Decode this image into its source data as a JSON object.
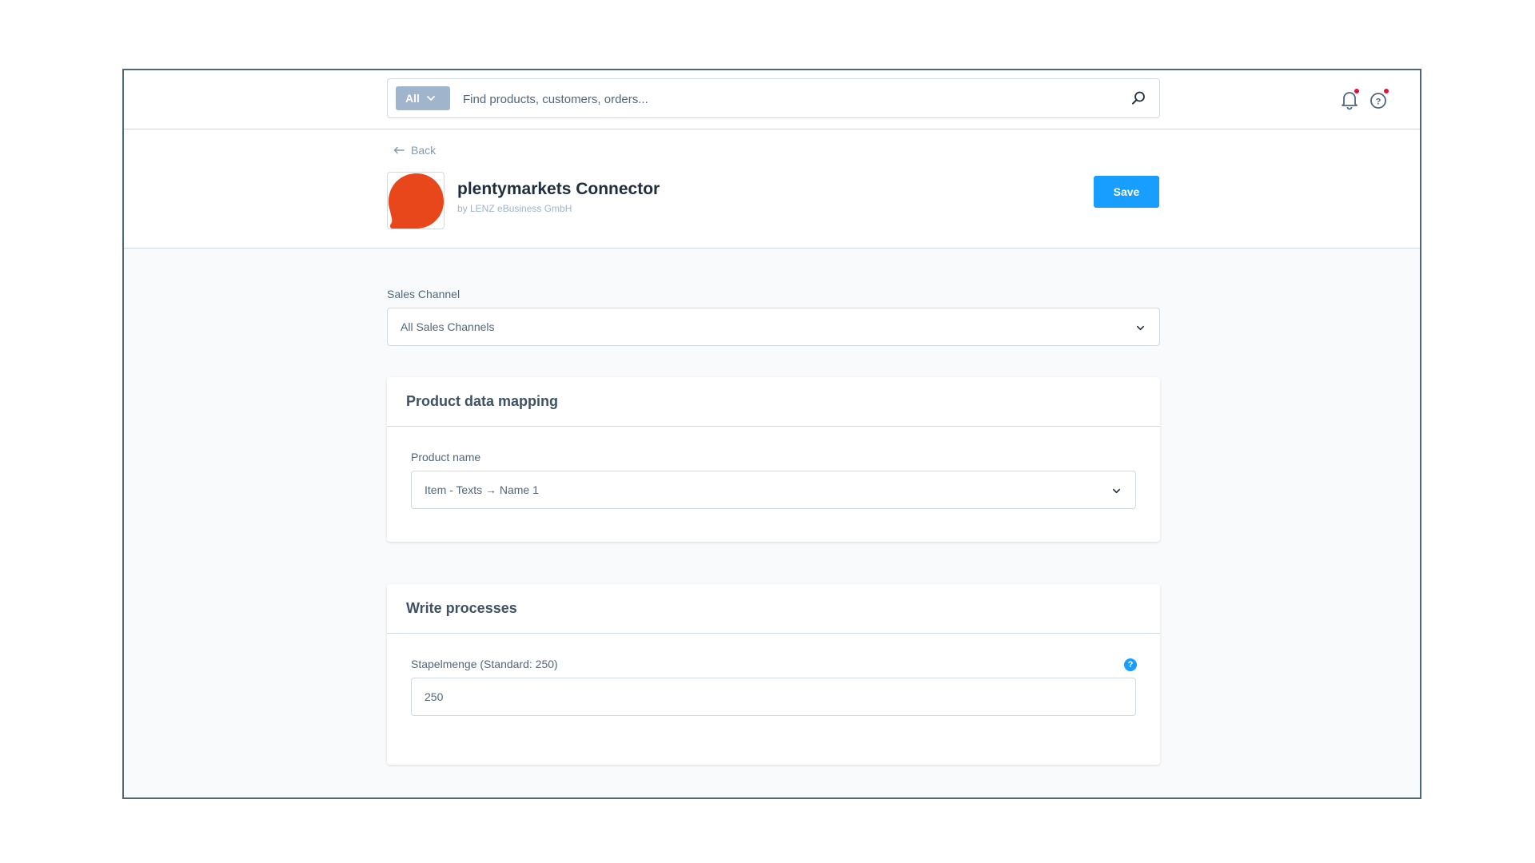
{
  "search": {
    "type_label": "All",
    "placeholder": "Find products, customers, orders..."
  },
  "header": {
    "back_label": "Back",
    "app_title": "plentymarkets Connector",
    "app_vendor": "by LENZ eBusiness GmbH",
    "save_label": "Save",
    "logo_color": "#e8461b"
  },
  "sales_channel": {
    "label": "Sales Channel",
    "value": "All Sales Channels"
  },
  "product_mapping": {
    "title": "Product data mapping",
    "product_name_label": "Product name",
    "product_name_value": "Item - Texts → Name 1"
  },
  "write_processes": {
    "title": "Write processes",
    "batch_label": "Stapelmenge (Standard: 250)",
    "batch_value": "250",
    "help_glyph": "?"
  },
  "colors": {
    "accent": "#189eff",
    "notification": "#e0133c"
  }
}
